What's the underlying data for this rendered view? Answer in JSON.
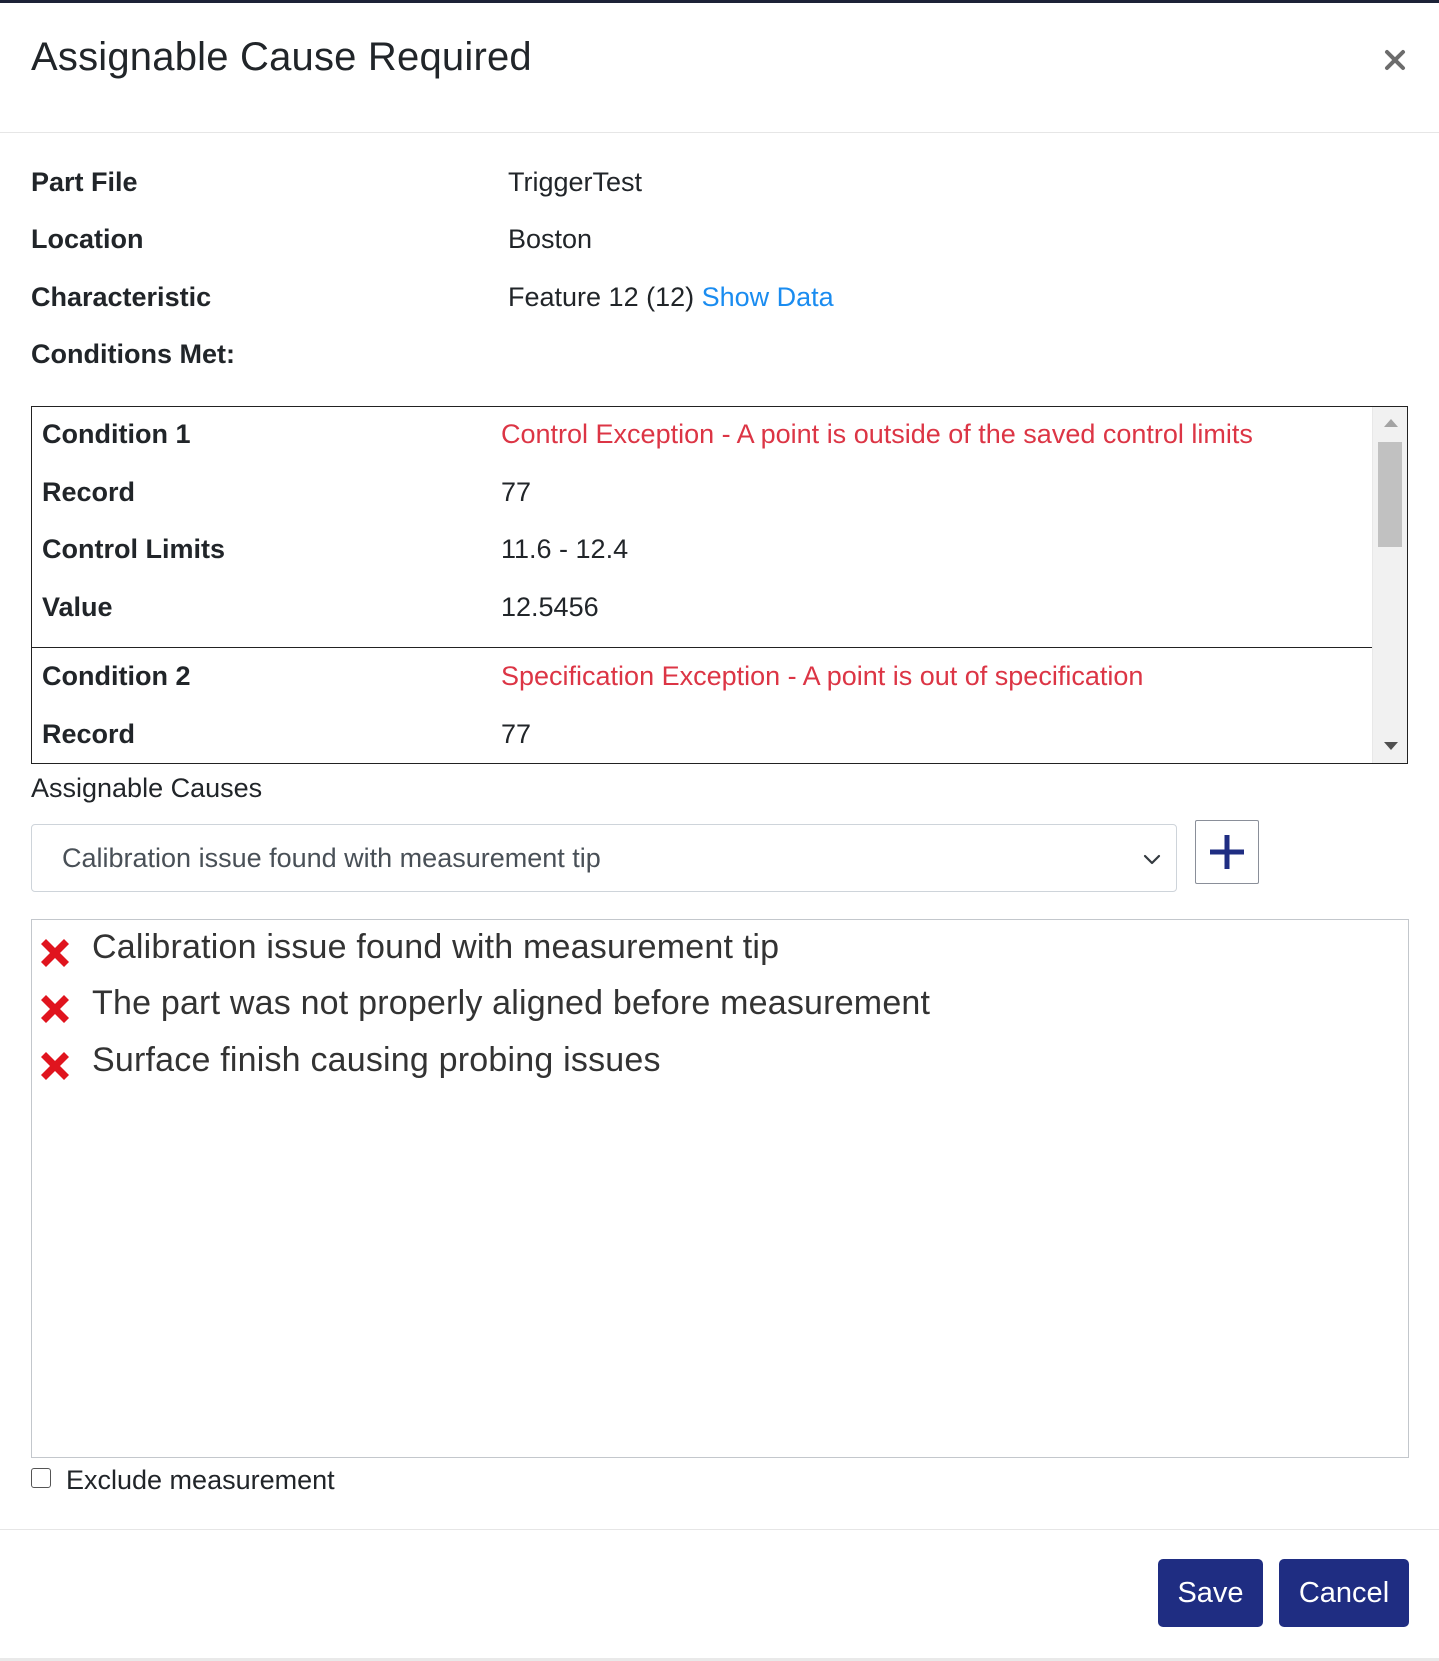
{
  "dialog": {
    "title": "Assignable Cause Required",
    "close_label": "×"
  },
  "info": {
    "part_file_label": "Part File",
    "part_file_value": "TriggerTest",
    "location_label": "Location",
    "location_value": "Boston",
    "characteristic_label": "Characteristic",
    "characteristic_value": "Feature 12 (12)",
    "show_data_link": "Show Data",
    "conditions_met_label": "Conditions Met:"
  },
  "conditions": [
    {
      "condition_label": "Condition 1",
      "condition_text": "Control Exception - A point is outside of the saved control limits",
      "record_label": "Record",
      "record_value": "77",
      "limits_label": "Control Limits",
      "limits_value": "11.6 - 12.4",
      "value_label": "Value",
      "value_value": "12.5456"
    },
    {
      "condition_label": "Condition 2",
      "condition_text": "Specification Exception - A point is out of specification",
      "record_label": "Record",
      "record_value": "77"
    }
  ],
  "assignable_causes": {
    "label": "Assignable Causes",
    "selected": "Calibration issue found with measurement tip",
    "add_button_icon": "plus-icon",
    "items": [
      "Calibration issue found with measurement tip",
      "The part was not properly aligned before measurement",
      "Surface finish causing probing issues"
    ]
  },
  "exclude": {
    "label": "Exclude measurement",
    "checked": false
  },
  "footer": {
    "save_label": "Save",
    "cancel_label": "Cancel"
  },
  "colors": {
    "primary": "#1f2d82",
    "danger": "#dc3545",
    "link": "#1a8cf0",
    "remove_icon": "#e0141e"
  }
}
